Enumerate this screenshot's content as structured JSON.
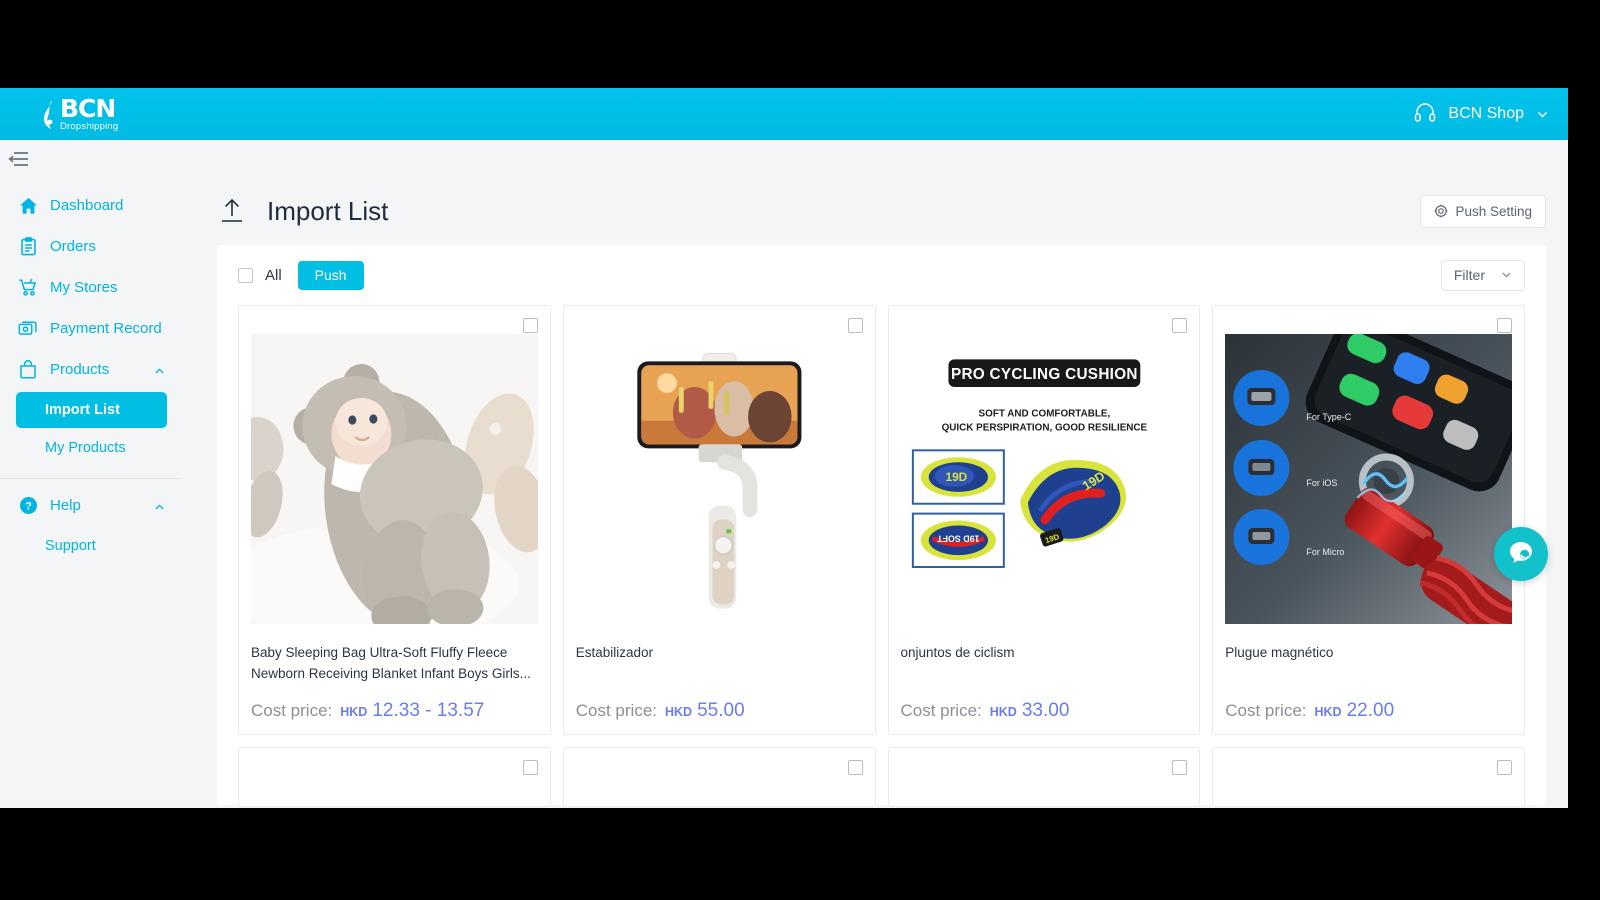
{
  "topbar": {
    "logo_main": "BCN",
    "logo_sub": "Dropshipping",
    "support_icon": "headset-icon",
    "shop_name": "BCN Shop",
    "chevron_icon": "chevron-down-icon"
  },
  "collapse": {
    "icon": "sidebar-collapse-icon"
  },
  "sidebar": {
    "items": [
      {
        "label": "Dashboard",
        "icon": "home-icon"
      },
      {
        "label": "Orders",
        "icon": "clipboard-icon"
      },
      {
        "label": "My Stores",
        "icon": "cart-icon"
      },
      {
        "label": "Payment Record",
        "icon": "payment-card-icon"
      },
      {
        "label": "Products",
        "icon": "bag-icon",
        "caret": "chevron-up-icon"
      }
    ],
    "product_children": [
      {
        "label": "Import List",
        "active": true
      },
      {
        "label": "My Products",
        "active": false
      }
    ],
    "help": {
      "label": "Help",
      "icon": "question-circle-icon",
      "caret": "chevron-up-icon"
    },
    "help_children": [
      {
        "label": "Support"
      }
    ]
  },
  "page": {
    "title": "Import List",
    "title_icon": "upload-icon",
    "push_setting_label": "Push Setting",
    "push_setting_icon": "gear-icon"
  },
  "toolbar": {
    "all_label": "All",
    "push_label": "Push",
    "filter_label": "Filter",
    "filter_icon": "chevron-down-icon"
  },
  "products": [
    {
      "title": "Baby Sleeping Bag Ultra-Soft Fluffy Fleece Newborn Receiving Blanket Infant Boys Girls...",
      "cost_label": "Cost price:",
      "currency": "HKD",
      "amount": "12.33 - 13.57",
      "image": "baby-sleeping-bag-photo"
    },
    {
      "title": "Estabilizador",
      "cost_label": "Cost price:",
      "currency": "HKD",
      "amount": "55.00",
      "image": "phone-gimbal-stabilizer-photo"
    },
    {
      "title": "onjuntos de ciclism",
      "cost_label": "Cost price:",
      "currency": "HKD",
      "amount": "33.00",
      "image": "pro-cycling-cushion-photo",
      "image_text": {
        "headline": "PRO CYCLING CUSHION",
        "line1": "SOFT AND COMFORTABLE,",
        "line2": "QUICK PERSPIRATION, GOOD RESILIENCE",
        "pad_label": "19D"
      }
    },
    {
      "title": "Plugue magnético",
      "cost_label": "Cost price:",
      "currency": "HKD",
      "amount": "22.00",
      "image": "magnetic-cable-photo",
      "image_text": {
        "tip1": "For Type-C",
        "tip2": "For iOS",
        "tip3": "For Micro"
      }
    }
  ],
  "chat": {
    "icon": "chat-bubble-icon"
  },
  "colors": {
    "brand_cyan": "#00bfe3",
    "price_blue": "#6b7cf0",
    "chat_teal": "#12c1c9",
    "page_bg": "#f4f5f7",
    "title_dark": "#1f2c3d"
  }
}
